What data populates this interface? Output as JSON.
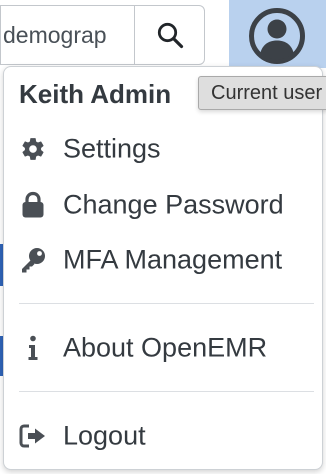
{
  "search": {
    "value": "demograp"
  },
  "tooltip": {
    "text": "Current user"
  },
  "dropdown": {
    "username": "Keith Admin",
    "items": [
      {
        "label": "Settings",
        "icon": "gear-icon"
      },
      {
        "label": "Change Password",
        "icon": "lock-icon"
      },
      {
        "label": "MFA Management",
        "icon": "key-icon"
      },
      {
        "label": "About OpenEMR",
        "icon": "info-icon"
      },
      {
        "label": "Logout",
        "icon": "sign-out-icon"
      }
    ]
  },
  "colors": {
    "user_button_bg": "#b9d1ee",
    "text": "#343a40",
    "icon": "#4a4f55",
    "background_accent": "#2f63b8"
  }
}
